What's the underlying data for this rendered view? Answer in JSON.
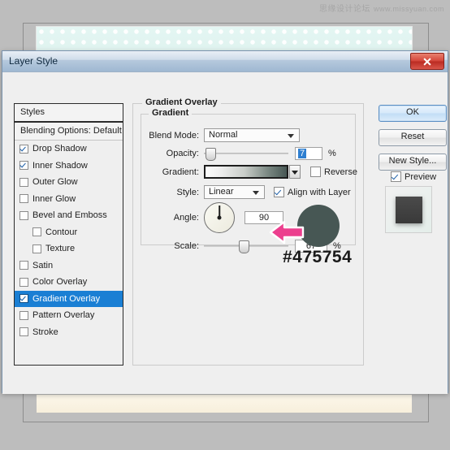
{
  "watermark": {
    "cn": "思缘设计论坛",
    "en": "www.missyuan.com"
  },
  "dialog": {
    "title": "Layer Style",
    "close_icon": "close-icon"
  },
  "styles_panel": {
    "header": "Styles",
    "blending_options": "Blending Options: Default",
    "items": [
      {
        "label": "Drop Shadow",
        "checked": true,
        "indent": false,
        "selected": false
      },
      {
        "label": "Inner Shadow",
        "checked": true,
        "indent": false,
        "selected": false
      },
      {
        "label": "Outer Glow",
        "checked": false,
        "indent": false,
        "selected": false
      },
      {
        "label": "Inner Glow",
        "checked": false,
        "indent": false,
        "selected": false
      },
      {
        "label": "Bevel and Emboss",
        "checked": false,
        "indent": false,
        "selected": false
      },
      {
        "label": "Contour",
        "checked": false,
        "indent": true,
        "selected": false
      },
      {
        "label": "Texture",
        "checked": false,
        "indent": true,
        "selected": false
      },
      {
        "label": "Satin",
        "checked": false,
        "indent": false,
        "selected": false
      },
      {
        "label": "Color Overlay",
        "checked": false,
        "indent": false,
        "selected": false
      },
      {
        "label": "Gradient Overlay",
        "checked": true,
        "indent": false,
        "selected": true
      },
      {
        "label": "Pattern Overlay",
        "checked": false,
        "indent": false,
        "selected": false
      },
      {
        "label": "Stroke",
        "checked": false,
        "indent": false,
        "selected": false
      }
    ]
  },
  "gradient_overlay": {
    "group_title": "Gradient Overlay",
    "inner_title": "Gradient",
    "blend_mode": {
      "label": "Blend Mode:",
      "value": "Normal"
    },
    "opacity": {
      "label": "Opacity:",
      "value": "7",
      "unit": "%"
    },
    "gradient": {
      "label": "Gradient:"
    },
    "reverse": {
      "label": "Reverse",
      "checked": false
    },
    "style": {
      "label": "Style:",
      "value": "Linear"
    },
    "align_with_layer": {
      "label": "Align with Layer",
      "checked": true
    },
    "angle": {
      "label": "Angle:",
      "value": "90",
      "unit": "°"
    },
    "scale": {
      "label": "Scale:",
      "value": "67",
      "unit": "%"
    }
  },
  "annotation": {
    "hex": "#475754",
    "swatch_color": "#475754",
    "arrow_color": "#ec3f8e"
  },
  "buttons": {
    "ok": "OK",
    "reset": "Reset",
    "new_style": "New Style...",
    "preview": {
      "label": "Preview",
      "checked": true
    }
  }
}
